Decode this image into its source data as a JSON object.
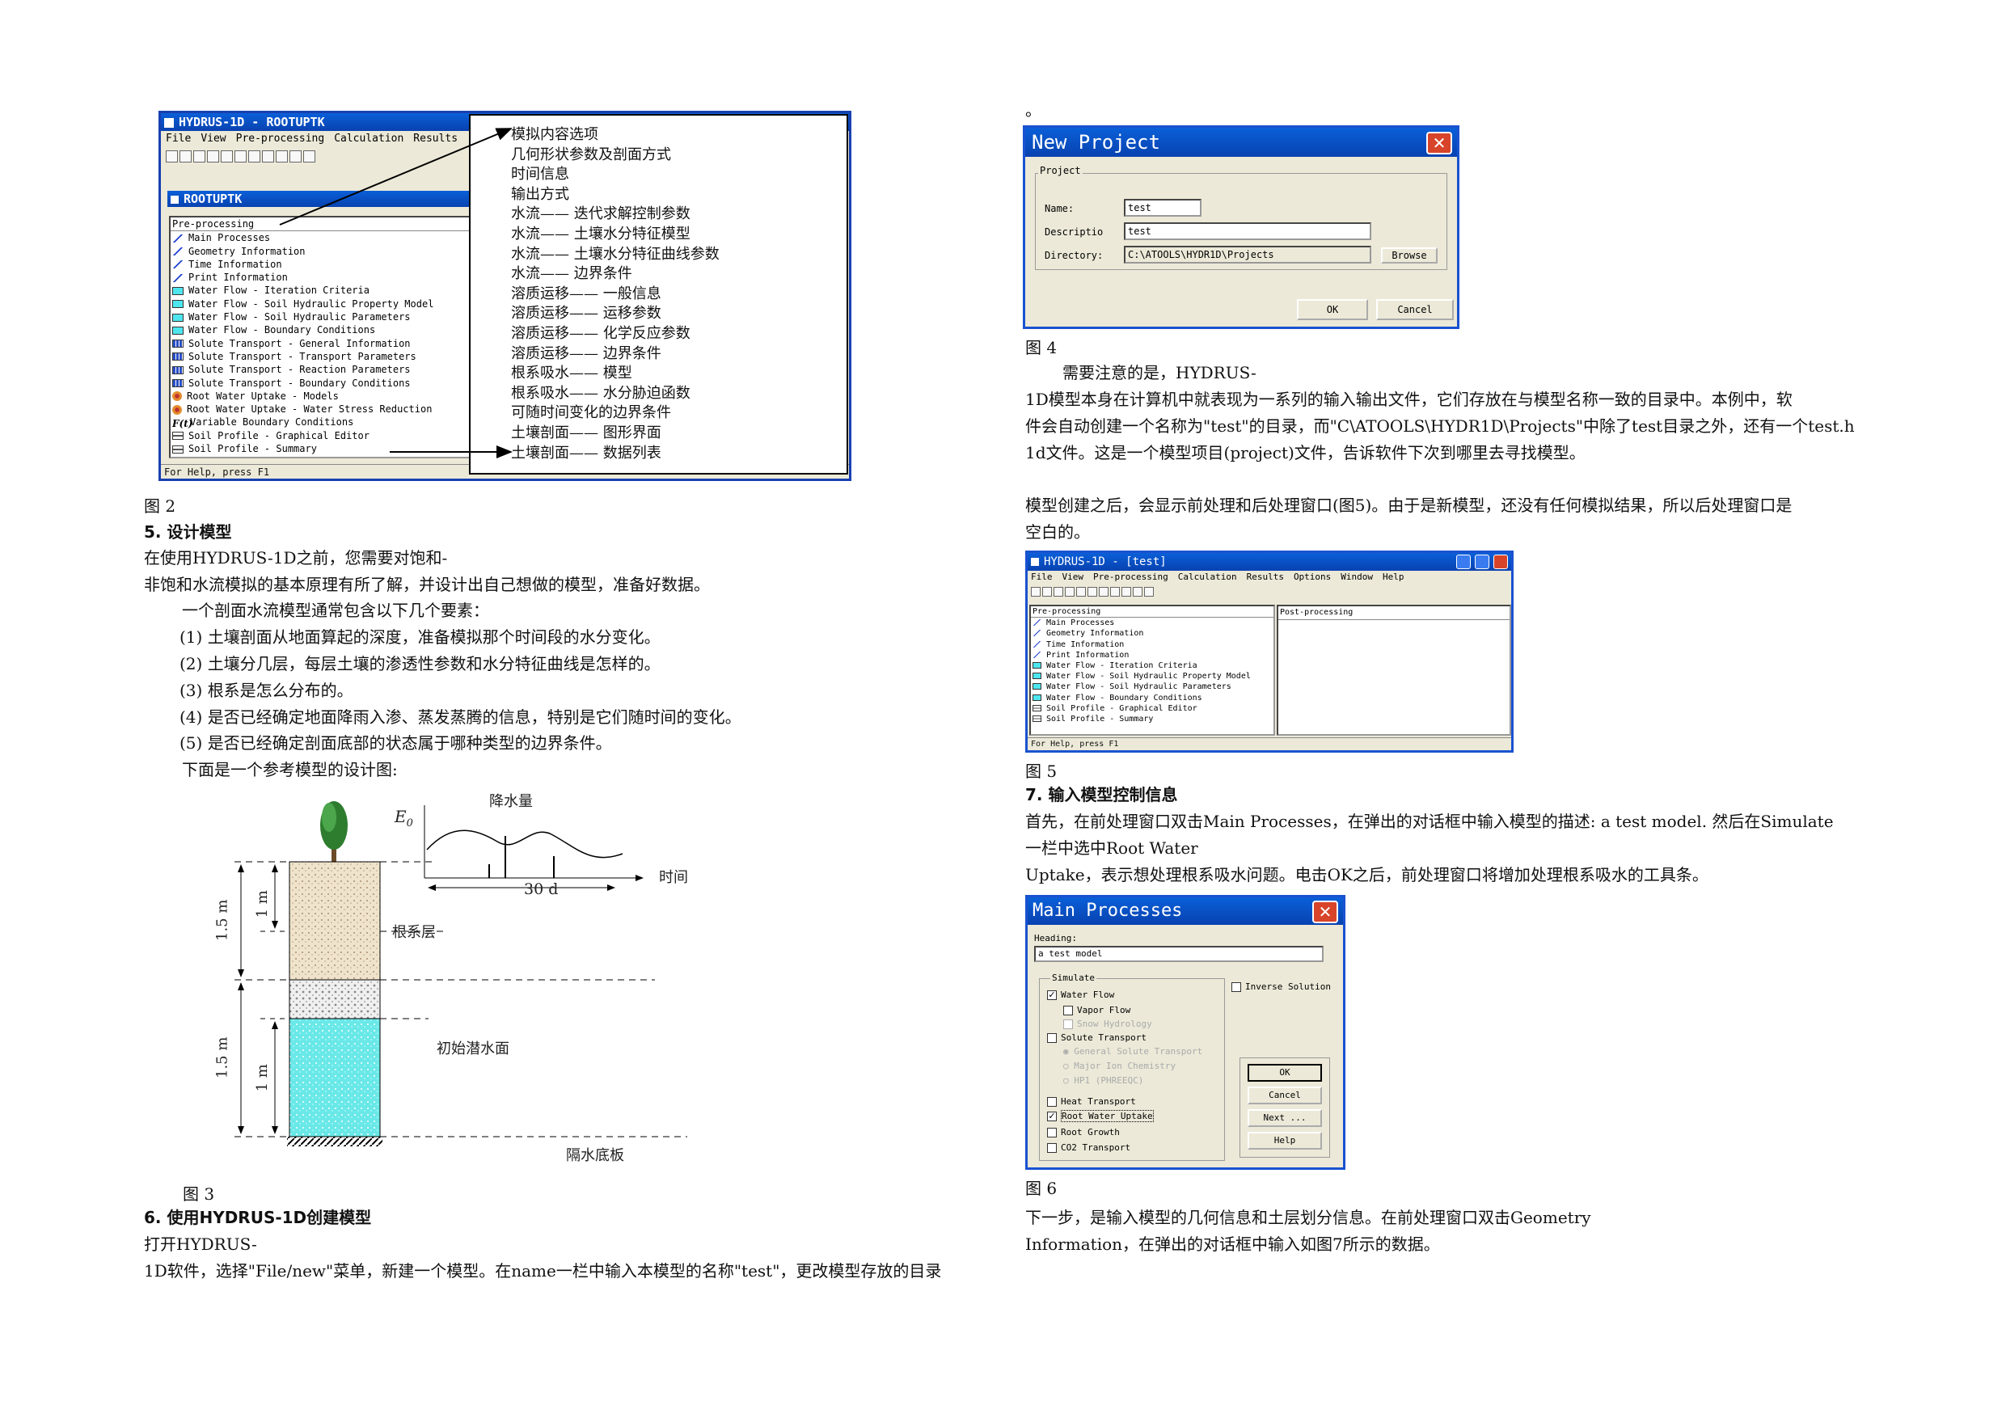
{
  "fig2": {
    "title": "HYDRUS-1D - ROOTUPTK",
    "menu": [
      "File",
      "View",
      "Pre-processing",
      "Calculation",
      "Results"
    ],
    "subtitle": "ROOTUPTK",
    "panel_header": "Pre-processing",
    "items": [
      {
        "icon": "pen",
        "label": "Main Processes"
      },
      {
        "icon": "pen",
        "label": "Geometry Information"
      },
      {
        "icon": "pen",
        "label": "Time Information"
      },
      {
        "icon": "pen",
        "label": "Print Information"
      },
      {
        "icon": "cyan",
        "label": "Water Flow - Iteration Criteria"
      },
      {
        "icon": "cyan",
        "label": "Water Flow - Soil Hydraulic Property Model"
      },
      {
        "icon": "cyan",
        "label": "Water Flow - Soil Hydraulic Parameters"
      },
      {
        "icon": "cyan",
        "label": "Water Flow - Boundary Conditions"
      },
      {
        "icon": "grid",
        "label": "Solute Transport - General Information"
      },
      {
        "icon": "grid",
        "label": "Solute Transport - Transport Parameters"
      },
      {
        "icon": "grid",
        "label": "Solute Transport - Reaction Parameters"
      },
      {
        "icon": "grid",
        "label": "Solute Transport - Boundary Conditions"
      },
      {
        "icon": "plant",
        "label": "Root Water Uptake - Models"
      },
      {
        "icon": "plant",
        "label": "Root Water Uptake - Water Stress Reduction"
      },
      {
        "icon": "fx",
        "label": "Variable Boundary Conditions"
      },
      {
        "icon": "soil",
        "label": "Soil Profile - Graphical Editor"
      },
      {
        "icon": "soil",
        "label": "Soil Profile - Summary"
      }
    ],
    "status": "For Help, press F1",
    "annotations": [
      "模拟内容选项",
      "几何形状参数及剖面方式",
      "时间信息",
      "输出方式",
      "水流—— 迭代求解控制参数",
      "水流—— 土壤水分特征模型",
      "水流—— 土壤水分特征曲线参数",
      "水流—— 边界条件",
      "溶质运移—— 一般信息",
      "溶质运移—— 运移参数",
      "溶质运移—— 化学反应参数",
      "溶质运移—— 边界条件",
      "根系吸水—— 模型",
      "根系吸水—— 水分胁迫函数",
      "可随时间变化的边界条件",
      "土壤剖面—— 图形界面",
      "土壤剖面—— 数据列表"
    ],
    "caption": "图 2"
  },
  "left": {
    "h5": "5. 设计模型",
    "p1a": "在使用HYDRUS-1D之前，您需要对饱和-",
    "p1b": "非饱和水流模拟的基本原理有所了解，并设计出自己想做的模型，准备好数据。",
    "p2": "一个剖面水流模型通常包含以下几个要素：",
    "list": [
      "(1)  土壤剖面从地面算起的深度，准备模拟那个时间段的水分变化。",
      "(2)  土壤分几层，每层土壤的渗透性参数和水分特征曲线是怎样的。",
      "(3)  根系是怎么分布的。",
      "(4)  是否已经确定地面降雨入渗、蒸发蒸腾的信息，特别是它们随时间的变化。",
      "(5)  是否已经确定剖面底部的状态属于哪种类型的边界条件。"
    ],
    "p3": "下面是一个参考模型的设计图:",
    "fig3": {
      "e0": "E",
      "e0sub": "0",
      "rain": "降水量",
      "days": "30 d",
      "time": "时间",
      "root_layer": "根系层",
      "water_table": "初始潜水面",
      "bottom": "隔水底板",
      "d15a": "1.5 m",
      "d1a": "1 m",
      "d15b": "1.5 m",
      "d1b": "1 m",
      "caption": "图 3"
    },
    "h6": "6. 使用HYDRUS-1D创建模型",
    "p4a": "打开HYDRUS-",
    "p4b": "1D软件，选择\"File/new\"菜单，新建一个模型。在name一栏中输入本模型的名称\"test\"，更改模型存放的目录"
  },
  "right": {
    "dot": "。",
    "fig4": {
      "title": "New Project",
      "group": "Project",
      "name_label": "Name:",
      "name_value": "test",
      "desc_label": "Descriptio",
      "desc_value": "test",
      "dir_label": "Directory:",
      "dir_value": "C:\\ATOOLS\\HYDR1D\\Projects",
      "browse": "Browse",
      "ok": "OK",
      "cancel": "Cancel",
      "caption": "图 4"
    },
    "p1a": "需要注意的是，HYDRUS-",
    "p1b": "1D模型本身在计算机中就表现为一系列的输入输出文件，它们存放在与模型名称一致的目录中。本例中，软",
    "p1c": "件会自动创建一个名称为\"test\"的目录，而\"C\\ATOOLS\\HYDR1D\\Projects\"中除了test目录之外，还有一个test.h",
    "p1d": "1d文件。这是一个模型项目(project)文件，告诉软件下次到哪里去寻找模型。",
    "p2a": "模型创建之后，会显示前处理和后处理窗口(图5)。由于是新模型，还没有任何模拟结果，所以后处理窗口是",
    "p2b": "空白的。",
    "fig5": {
      "title": "HYDRUS-1D - [test]",
      "menu": [
        "File",
        "View",
        "Pre-processing",
        "Calculation",
        "Results",
        "Options",
        "Window",
        "Help"
      ],
      "pre_header": "Pre-processing",
      "post_header": "Post-processing",
      "items": [
        {
          "icon": "pen",
          "label": "Main Processes"
        },
        {
          "icon": "pen",
          "label": "Geometry Information"
        },
        {
          "icon": "pen",
          "label": "Time Information"
        },
        {
          "icon": "pen",
          "label": "Print Information"
        },
        {
          "icon": "cyan",
          "label": "Water Flow - Iteration Criteria"
        },
        {
          "icon": "cyan",
          "label": "Water Flow - Soil Hydraulic Property Model"
        },
        {
          "icon": "cyan",
          "label": "Water Flow - Soil Hydraulic Parameters"
        },
        {
          "icon": "cyan",
          "label": "Water Flow - Boundary Conditions"
        },
        {
          "icon": "soil",
          "label": "Soil Profile - Graphical Editor"
        },
        {
          "icon": "soil",
          "label": "Soil Profile - Summary"
        }
      ],
      "status": "For Help, press F1",
      "caption": "图 5"
    },
    "h7": "7. 输入模型控制信息",
    "p3a": "首先，在前处理窗口双击Main Processes，在弹出的对话框中输入模型的描述: a test model. 然后在Simulate",
    "p3b": "一栏中选中Root Water",
    "p3c": "Uptake，表示想处理根系吸水问题。电击OK之后，前处理窗口将增加处理根系吸水的工具条。",
    "fig6": {
      "title": "Main Processes",
      "heading_label": "Heading:",
      "heading_value": "a test model",
      "simulate": "Simulate",
      "water_flow": "Water Flow",
      "vapor_flow": "Vapor Flow",
      "snow": "Snow Hydrology",
      "solute": "Solute Transport",
      "general": "General Solute Transport",
      "major": "Major Ion Chemistry",
      "hp1": "HP1 (PHREEQC)",
      "heat": "Heat Transport",
      "root_uptake": "Root Water Uptake",
      "root_growth": "Root Growth",
      "co2": "CO2 Transport",
      "inverse": "Inverse Solution",
      "ok": "OK",
      "cancel": "Cancel",
      "next": "Next ...",
      "help": "Help",
      "water_flow_checked": true,
      "root_uptake_checked": true,
      "caption": "图 6"
    },
    "p4a": "下一步，是输入模型的几何信息和土层划分信息。在前处理窗口双击Geometry",
    "p4b": "Information，在弹出的对话框中输入如图7所示的数据。"
  }
}
